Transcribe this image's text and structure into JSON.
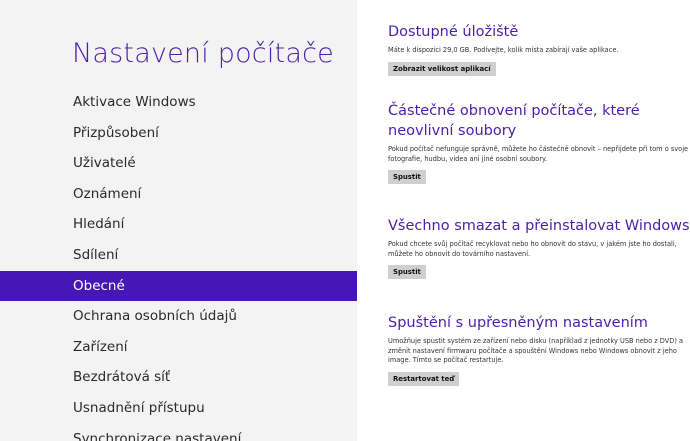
{
  "sidebar": {
    "title": "Nastavení počítače",
    "items": [
      {
        "label": "Aktivace Windows",
        "selected": false
      },
      {
        "label": "Přizpůsobení",
        "selected": false
      },
      {
        "label": "Uživatelé",
        "selected": false
      },
      {
        "label": "Oznámení",
        "selected": false
      },
      {
        "label": "Hledání",
        "selected": false
      },
      {
        "label": "Sdílení",
        "selected": false
      },
      {
        "label": "Obecné",
        "selected": true
      },
      {
        "label": "Ochrana osobních údajů",
        "selected": false
      },
      {
        "label": "Zařízení",
        "selected": false
      },
      {
        "label": "Bezdrátová síť",
        "selected": false
      },
      {
        "label": "Usnadnění přístupu",
        "selected": false
      },
      {
        "label": "Synchronizace nastavení",
        "selected": false
      }
    ]
  },
  "main": {
    "storage": {
      "title": "Dostupné úložiště",
      "desc": "Máte k dispozici 29,0 GB. Podívejte, kolik místa zabírají vaše aplikace.",
      "button": "Zobrazit velikost aplikací"
    },
    "refresh": {
      "title": "Částečné obnovení počítače, které neovlivní soubory",
      "desc": "Pokud počítač nefunguje správně, můžete ho částečně obnovit – nepřijdete při tom o svoje fotografie, hudbu, videa ani jiné osobní soubory.",
      "button": "Spustit"
    },
    "reset": {
      "title": "Všechno smazat a přeinstalovat Windows",
      "desc": "Pokud chcete svůj počítač recyklovat nebo ho obnovit do stavu, v jakém jste ho dostali, můžete ho obnovit do továrního nastavení.",
      "button": "Spustit"
    },
    "advanced": {
      "title": "Spuštění s upřesněným nastavením",
      "desc": "Umožňuje spustit systém ze zařízení nebo disku (například z jednotky USB nebo z DVD) a změnit nastavení firmwaru počítače a spouštění Windows nebo Windows obnovit z jeho image. Tímto se počítač restartuje.",
      "button": "Restartovat teď"
    }
  },
  "colors": {
    "accent": "#4b1fa8",
    "selected_bg": "#4617b4",
    "sidebar_bg": "#f3f3f3",
    "button_bg": "#cfcfcf"
  }
}
